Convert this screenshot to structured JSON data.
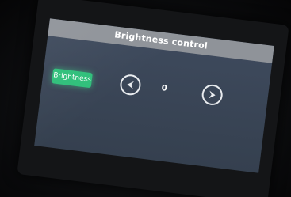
{
  "header": {
    "title": "Brightness control"
  },
  "controls": {
    "brightness_label": "Brightness",
    "value": "0",
    "decrease_icon": "arrow-left-icon",
    "increase_icon": "arrow-right-icon"
  },
  "colors": {
    "title_bar": "#8f9399",
    "screen_bg": "#3a4556",
    "button_green": "#2fbf7a",
    "icon_stroke": "#e9ecef"
  }
}
